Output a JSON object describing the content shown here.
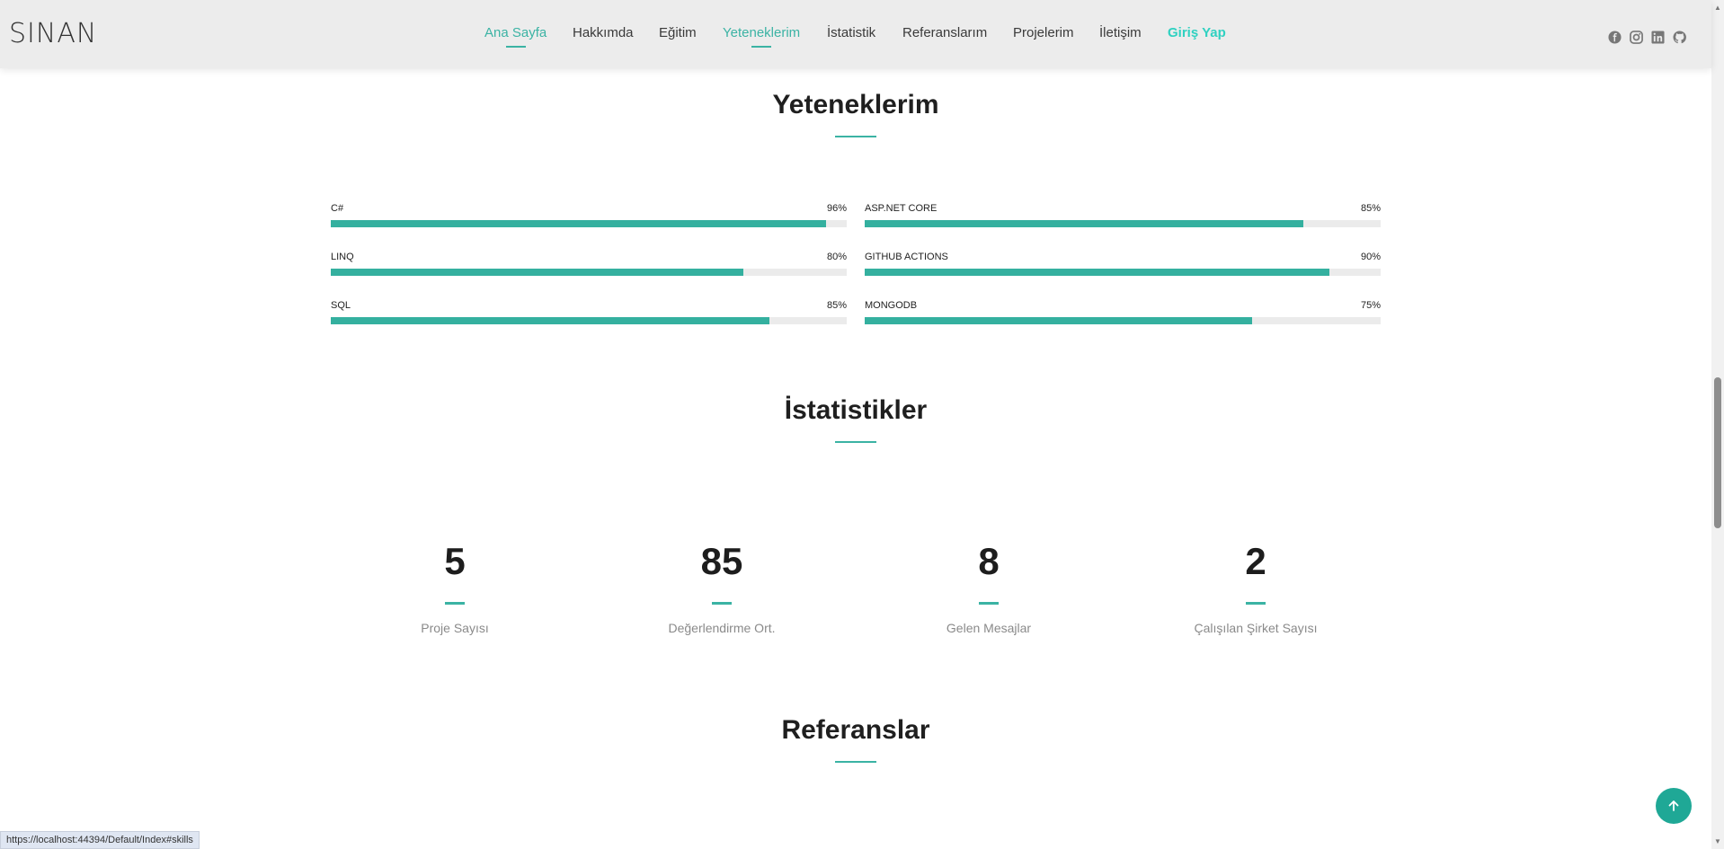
{
  "header": {
    "logo": "SINAN",
    "nav": [
      {
        "label": "Ana Sayfa",
        "active": true
      },
      {
        "label": "Hakkımda",
        "active": false
      },
      {
        "label": "Eğitim",
        "active": false
      },
      {
        "label": "Yeteneklerim",
        "active": true
      },
      {
        "label": "İstatistik",
        "active": false
      },
      {
        "label": "Referanslarım",
        "active": false
      },
      {
        "label": "Projelerim",
        "active": false
      },
      {
        "label": "İletişim",
        "active": false
      },
      {
        "label": "Giriş Yap",
        "active": false
      }
    ],
    "social_icons": [
      "facebook-icon",
      "instagram-icon",
      "linkedin-icon",
      "github-icon"
    ]
  },
  "skills": {
    "title": "Yeteneklerim",
    "items": [
      {
        "name": "C#",
        "value": "96%",
        "percent": 96
      },
      {
        "name": "ASP.NET CORE",
        "value": "85%",
        "percent": 85
      },
      {
        "name": "LINQ",
        "value": "80%",
        "percent": 80
      },
      {
        "name": "GITHUB ACTIONS",
        "value": "90%",
        "percent": 90
      },
      {
        "name": "SQL",
        "value": "85%",
        "percent": 85
      },
      {
        "name": "MONGODB",
        "value": "75%",
        "percent": 75
      }
    ]
  },
  "stats": {
    "title": "İstatistikler",
    "items": [
      {
        "value": "5",
        "label": "Proje Sayısı"
      },
      {
        "value": "85",
        "label": "Değerlendirme Ort."
      },
      {
        "value": "8",
        "label": "Gelen Mesajlar"
      },
      {
        "value": "2",
        "label": "Çalışılan Şirket Sayısı"
      }
    ]
  },
  "references": {
    "title": "Referanslar"
  },
  "status_bar": {
    "url": "https://localhost:44394/Default/Index#skills"
  },
  "colors": {
    "accent": "#3bb3a4",
    "login": "#2fd1c1",
    "header_bg": "#ececec"
  }
}
